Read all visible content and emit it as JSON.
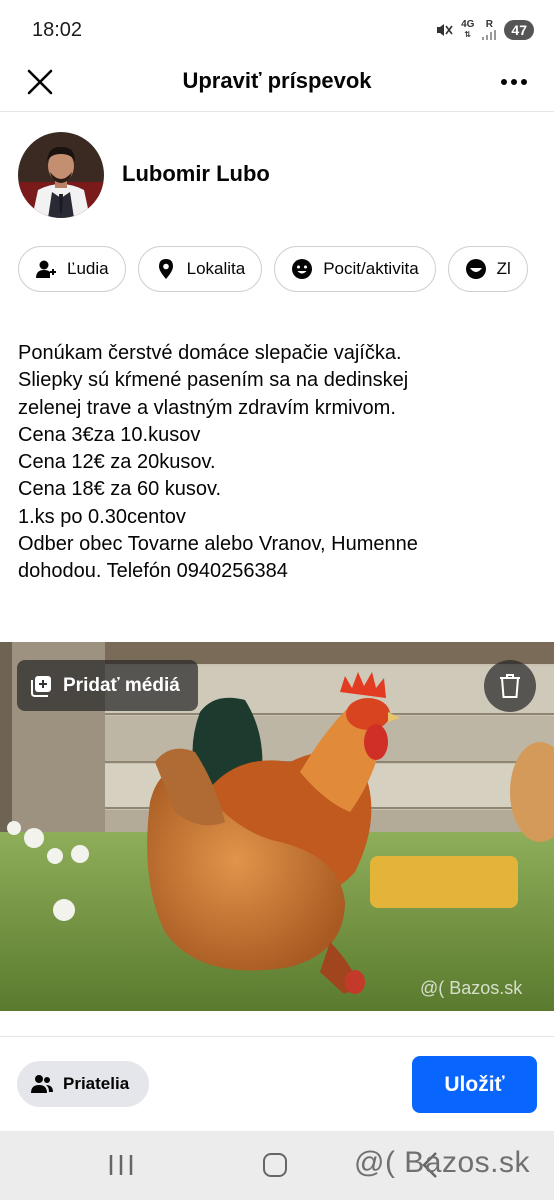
{
  "status_bar": {
    "time": "18:02",
    "network": "4G",
    "signal_letter": "R",
    "battery": "47"
  },
  "header": {
    "title": "Upraviť príspevok"
  },
  "author": {
    "name": "Lubomir Lubo"
  },
  "chips": [
    {
      "label": "Ľudia",
      "icon": "people-icon"
    },
    {
      "label": "Lokalita",
      "icon": "location-pin-icon"
    },
    {
      "label": "Pocit/aktivita",
      "icon": "smiley-icon"
    },
    {
      "label": "Zl",
      "icon": "smiley-icon"
    }
  ],
  "post": {
    "lines": [
      "Ponúkam čerstvé domáce slepačie vajíčka.",
      "Sliepky sú kŕmené pasením sa na dedinskej",
      "zelenej trave a vlastným zdravím krmivom.",
      "Cena 3€za 10.kusov",
      "Cena 12€ za 20kusov.",
      "Cena 18€ za 60 kusov.",
      "1.ks po 0.30centov",
      "Odber obec Tovarne alebo Vranov, Humenne",
      "dohodou. Telefón 0940256384"
    ]
  },
  "media": {
    "add_label": "Pridať médiá",
    "watermark": "@( Bazos.sk"
  },
  "footer": {
    "audience_label": "Priatelia",
    "save_label": "Uložiť"
  },
  "nav_watermark": "@( Bazos.sk",
  "colors": {
    "accent": "#0866ff",
    "chip_border": "#ced0d4",
    "audience_bg": "#e4e6eb"
  }
}
